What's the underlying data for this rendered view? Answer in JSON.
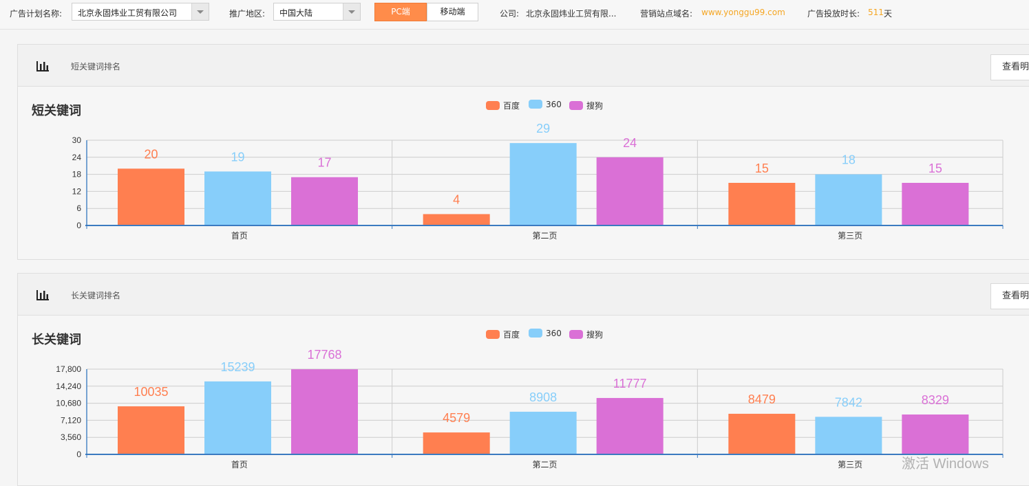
{
  "topbar": {
    "plan_label": "广告计划名称:",
    "plan_value": "北京永固炜业工贸有限公司",
    "region_label": "推广地区:",
    "region_value": "中国大陆",
    "pc_label": "PC端",
    "mobile_label": "移动端",
    "company_label": "公司:",
    "company_value": "北京永固炜业工贸有限...",
    "domain_label": "营销站点域名:",
    "domain_value": "www.yonggu99.com",
    "duration_label": "广告投放时长:",
    "duration_value": "511",
    "duration_unit": "天"
  },
  "panels": [
    {
      "header_title": "短关键词排名",
      "detail_button": "查看明",
      "chart_title": "短关键词"
    },
    {
      "header_title": "长关键词排名",
      "detail_button": "查看明",
      "chart_title": "长关键词"
    }
  ],
  "colors": {
    "baidu": "#ff7f50",
    "s360": "#87cefa",
    "sogou": "#da70d6",
    "accent": "#ff8c4a",
    "domain": "#f5a623"
  },
  "chart_data": [
    {
      "type": "bar",
      "categories": [
        "首页",
        "第二页",
        "第三页"
      ],
      "series": [
        {
          "name": "百度",
          "values": [
            20,
            4,
            15
          ],
          "color": "#ff7f50"
        },
        {
          "name": "360",
          "values": [
            19,
            29,
            18
          ],
          "color": "#87cefa"
        },
        {
          "name": "搜狗",
          "values": [
            17,
            24,
            15
          ],
          "color": "#da70d6"
        }
      ],
      "yticks": [
        "0",
        "6",
        "12",
        "18",
        "24",
        "30"
      ],
      "ylim": [
        0,
        30
      ],
      "grid": true,
      "legend": "top-center"
    },
    {
      "type": "bar",
      "categories": [
        "首页",
        "第二页",
        "第三页"
      ],
      "series": [
        {
          "name": "百度",
          "values": [
            10035,
            4579,
            8479
          ],
          "color": "#ff7f50"
        },
        {
          "name": "360",
          "values": [
            15239,
            8908,
            7842
          ],
          "color": "#87cefa"
        },
        {
          "name": "搜狗",
          "values": [
            17768,
            11777,
            8329
          ],
          "color": "#da70d6"
        }
      ],
      "yticks": [
        "0",
        "3,560",
        "7,120",
        "10,680",
        "14,240",
        "17,800"
      ],
      "ylim": [
        0,
        17800
      ],
      "grid": true,
      "legend": "top-center"
    }
  ],
  "watermark": "激活 Windows"
}
